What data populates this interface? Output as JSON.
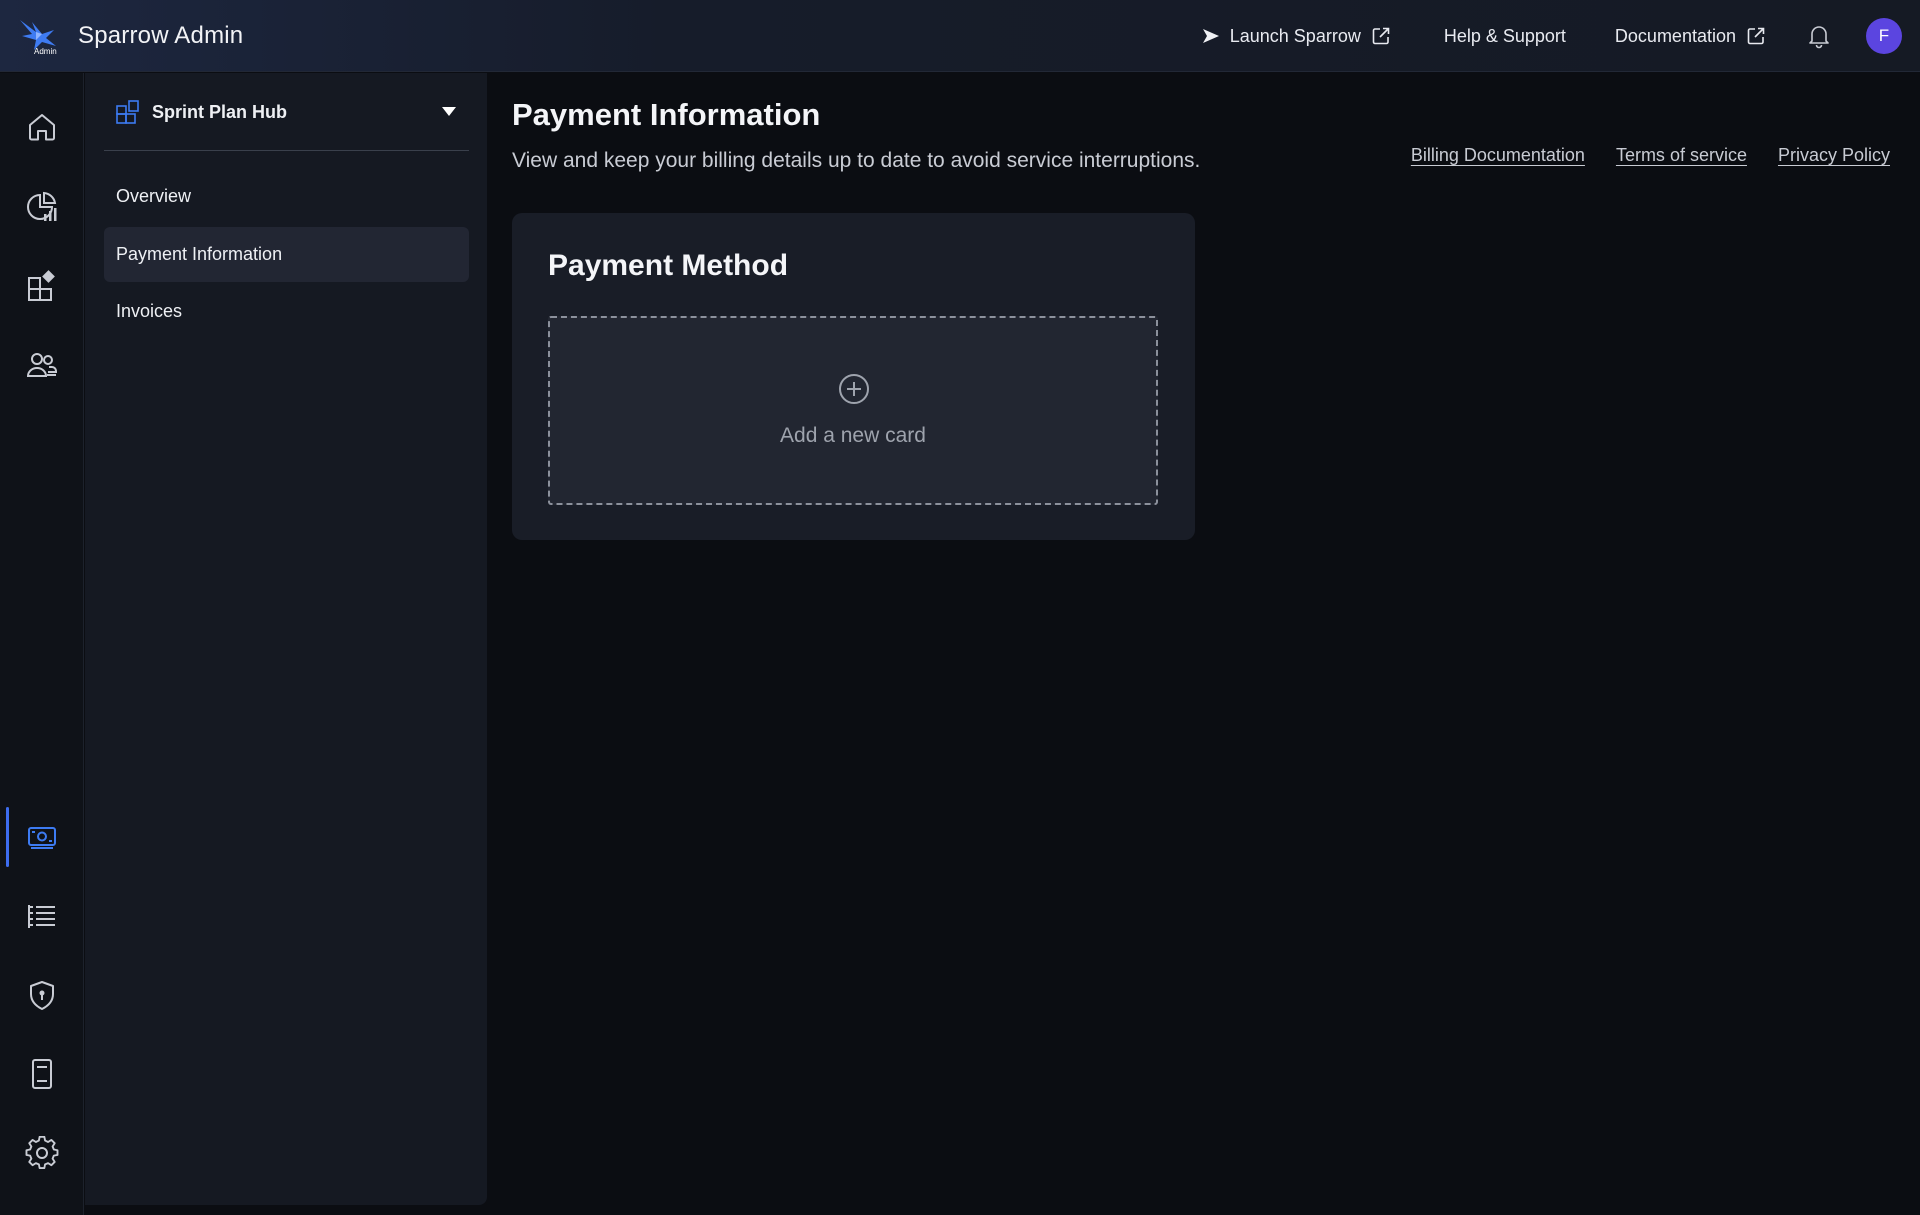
{
  "app": {
    "title": "Sparrow Admin",
    "logo_tag": "Admin"
  },
  "topbar": {
    "launch_label": "Launch Sparrow",
    "help_label": "Help & Support",
    "docs_label": "Documentation",
    "avatar_initial": "F",
    "avatar_color": "#5b45e0"
  },
  "rail": {
    "items": [
      {
        "icon": "home-icon"
      },
      {
        "icon": "analytics-icon"
      },
      {
        "icon": "workspaces-icon"
      },
      {
        "icon": "users-icon"
      },
      {
        "icon": "billing-icon",
        "active": true
      },
      {
        "icon": "list-icon"
      },
      {
        "icon": "shield-icon"
      },
      {
        "icon": "device-icon"
      },
      {
        "icon": "gear-icon"
      }
    ],
    "accent": "#3d6df0"
  },
  "subnav": {
    "workspace_name": "Sprint Plan Hub",
    "items": [
      {
        "label": "Overview"
      },
      {
        "label": "Payment Information",
        "active": true
      },
      {
        "label": "Invoices"
      }
    ]
  },
  "main": {
    "title": "Payment Information",
    "subtitle": "View and keep your billing details up to date to avoid service interruptions.",
    "links": {
      "billing_docs": "Billing Documentation",
      "terms": "Terms of service",
      "privacy": "Privacy Policy"
    },
    "card": {
      "title": "Payment Method",
      "add_label": "Add a new card"
    }
  }
}
